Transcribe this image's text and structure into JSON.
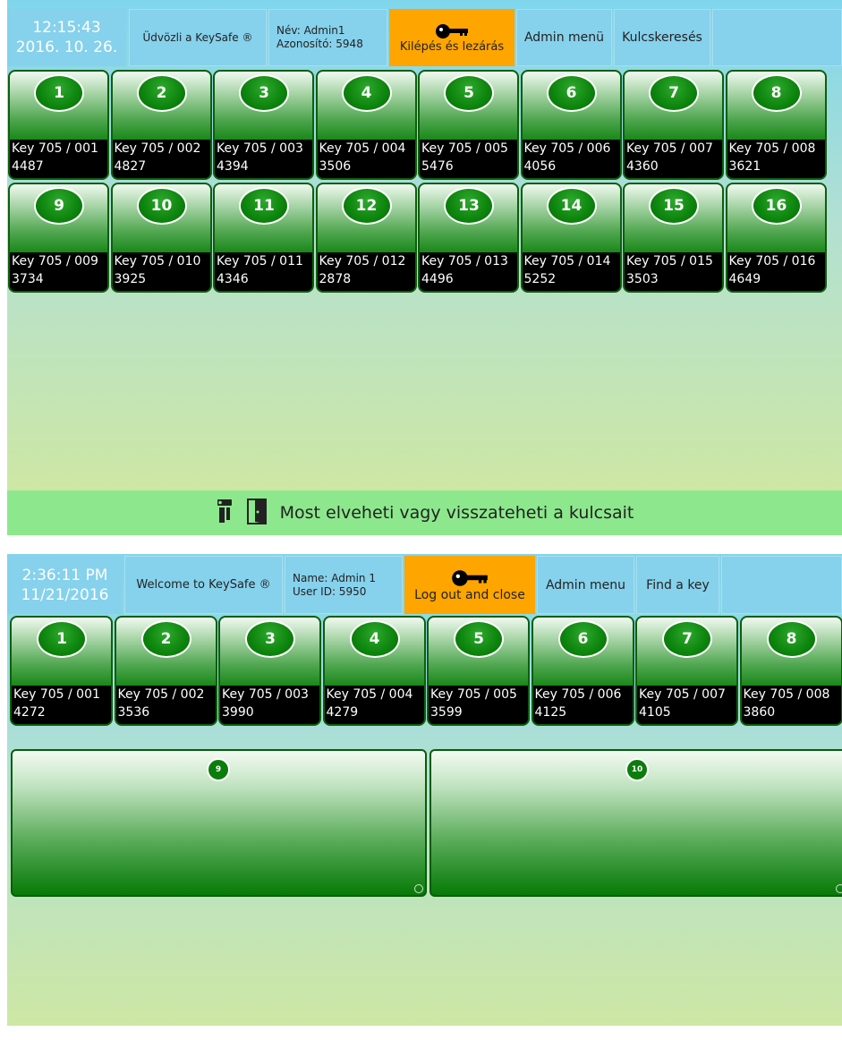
{
  "screen1": {
    "clock_time": "12:15:43",
    "clock_date": "2016. 10. 26.",
    "welcome": "Üdvözli a KeySafe ®",
    "user_name": "Név:  Admin1",
    "user_id": "Azonosító:  5948",
    "logout": "Kilépés és lezárás",
    "admin": "Admin menü",
    "search": "Kulcskeresés",
    "status_text": "Most elveheti vagy visszateheti a kulcsait",
    "tiles": [
      {
        "num": "1",
        "key": "Key 705 / 001",
        "code": "4487"
      },
      {
        "num": "2",
        "key": "Key 705 / 002",
        "code": "4827"
      },
      {
        "num": "3",
        "key": "Key 705 / 003",
        "code": "4394"
      },
      {
        "num": "4",
        "key": "Key 705 / 004",
        "code": "3506"
      },
      {
        "num": "5",
        "key": "Key 705 / 005",
        "code": "5476"
      },
      {
        "num": "6",
        "key": "Key 705 / 006",
        "code": "4056"
      },
      {
        "num": "7",
        "key": "Key 705 / 007",
        "code": "4360"
      },
      {
        "num": "8",
        "key": "Key 705 / 008",
        "code": "3621"
      },
      {
        "num": "9",
        "key": "Key 705 / 009",
        "code": "3734"
      },
      {
        "num": "10",
        "key": "Key 705 / 010",
        "code": "3925"
      },
      {
        "num": "11",
        "key": "Key 705 / 011",
        "code": "4346"
      },
      {
        "num": "12",
        "key": "Key 705 / 012",
        "code": "2878"
      },
      {
        "num": "13",
        "key": "Key 705 / 013",
        "code": "4496"
      },
      {
        "num": "14",
        "key": "Key 705 / 014",
        "code": "5252"
      },
      {
        "num": "15",
        "key": "Key 705 / 015",
        "code": "3503"
      },
      {
        "num": "16",
        "key": "Key 705 / 016",
        "code": "4649"
      }
    ]
  },
  "screen2": {
    "clock_time": "2:36:11 PM",
    "clock_date": "11/21/2016",
    "welcome": "Welcome to KeySafe ®",
    "user_name": "Name:  Admin 1",
    "user_id": "User ID:  5950",
    "logout": "Log out and close",
    "admin": "Admin menu",
    "search": "Find a key",
    "tiles": [
      {
        "num": "1",
        "key": "Key 705 / 001",
        "code": "4272"
      },
      {
        "num": "2",
        "key": "Key 705 / 002",
        "code": "3536"
      },
      {
        "num": "3",
        "key": "Key 705 / 003",
        "code": "3990"
      },
      {
        "num": "4",
        "key": "Key 705 / 004",
        "code": "4279"
      },
      {
        "num": "5",
        "key": "Key 705 / 005",
        "code": "3599"
      },
      {
        "num": "6",
        "key": "Key 705 / 006",
        "code": "4125"
      },
      {
        "num": "7",
        "key": "Key 705 / 007",
        "code": "4105"
      },
      {
        "num": "8",
        "key": "Key 705 / 008",
        "code": "3860"
      }
    ],
    "big_slots": [
      {
        "num": "9"
      },
      {
        "num": "10"
      }
    ]
  },
  "icons": {
    "logout": "key-icon",
    "status_left": "key-holder-icon",
    "status_right": "door-icon"
  },
  "colors": {
    "header_blue": "#86d1ec",
    "logout_orange": "#ffa500",
    "tile_green": "#087e08",
    "status_green": "#8de88d"
  }
}
